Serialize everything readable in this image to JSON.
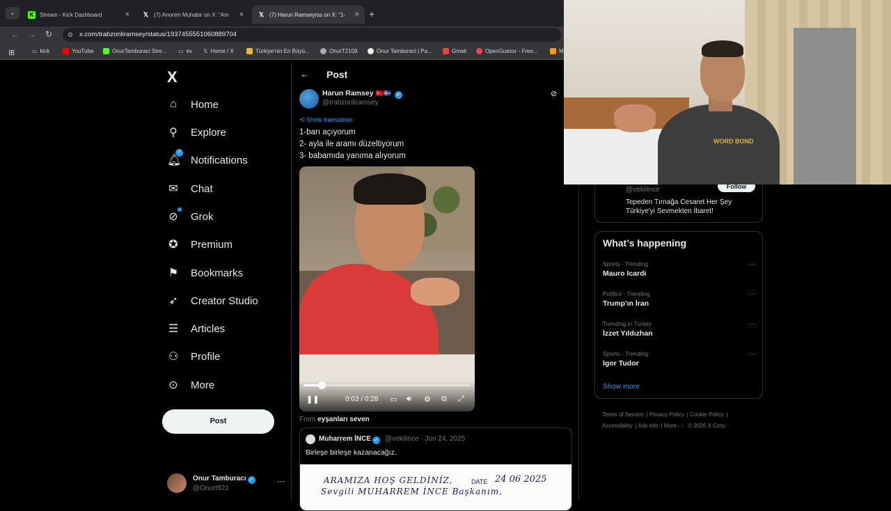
{
  "browser": {
    "tabs": [
      {
        "title": "Stream - Kick Dashboard",
        "favicon": "kick-icon",
        "active": false
      },
      {
        "title": "(7) Anonim Muhabir on X: \"Am",
        "favicon": "x-icon",
        "active": false
      },
      {
        "title": "(7) Harun Ramseyrss on X: \"1-",
        "favicon": "x-icon",
        "active": true
      }
    ],
    "url": "x.com/trabzonliramsey/status/1937455551060889704",
    "bookmarks": [
      "kick",
      "YouTube",
      "OnurTamburaci Stre...",
      "ev",
      "Home / X",
      "Türkiye'nin En Büyü...",
      "OnurT2109",
      "Onur Tamburaci | Pa...",
      "Gmail",
      "OpenGuessr - Free...",
      "M"
    ]
  },
  "sidebar": {
    "logo": "X",
    "items": [
      {
        "label": "Home",
        "icon": "home-icon"
      },
      {
        "label": "Explore",
        "icon": "search-icon"
      },
      {
        "label": "Notifications",
        "icon": "bell-icon",
        "badge": "7"
      },
      {
        "label": "Chat",
        "icon": "mail-icon"
      },
      {
        "label": "Grok",
        "icon": "grok-icon"
      },
      {
        "label": "Premium",
        "icon": "verified-icon"
      },
      {
        "label": "Bookmarks",
        "icon": "bookmark-icon"
      },
      {
        "label": "Creator Studio",
        "icon": "rocket-icon"
      },
      {
        "label": "Articles",
        "icon": "article-icon"
      },
      {
        "label": "Profile",
        "icon": "person-icon"
      },
      {
        "label": "More",
        "icon": "more-circle-icon"
      }
    ],
    "post_button": "Post",
    "account": {
      "name": "Onur Tamburacı",
      "handle": "@Onurt921"
    }
  },
  "main": {
    "title": "Post",
    "author": {
      "name": "Harun Ramsey",
      "flags": "🇹🇷🇮🇸",
      "handle": "@trabzonliramsey"
    },
    "show_translation": "Show translation",
    "text_lines": [
      "1-barı açıyorum",
      "2- ayla ile aramı düzeltiyorum",
      "3- babamıda yanıma alıyorum"
    ],
    "video": {
      "time": "0:03 / 0:28",
      "progress": 0.11
    },
    "from_label": "From",
    "from_source": "eyşanları seven",
    "quote": {
      "name": "Muharrem İNCE",
      "meta": "@vekilince · Jun 24, 2025",
      "text": "Birleşe birleşe kazanacağız.",
      "image_text_1": "ARAMIZA HOŞ GELDİNİZ,",
      "image_text_2": "Sevgili MUHARREM İNCE Başkanım,",
      "image_date_label": "DATE",
      "image_date": "24 06 2025"
    }
  },
  "right": {
    "suggest": {
      "handle": "@vekilince",
      "follow_label": "Follow",
      "bio": "Tepeden Tırnağa Cesaret Her Şey Türkiye'yi Sevmekten İbaret!"
    },
    "happening_title": "What’s happening",
    "trends": [
      {
        "context": "Sports · Trending",
        "name": "Mauro Icardi"
      },
      {
        "context": "Politics · Trending",
        "name": "Trump'ın İran"
      },
      {
        "context": "Trending in Turkey",
        "name": "İzzet Yıldızhan"
      },
      {
        "context": "Sports · Trending",
        "name": "Igor Tudor"
      }
    ],
    "show_more": "Show more",
    "footer": [
      "Terms of Service",
      "Privacy Policy",
      "Cookie Policy",
      "Accessibility",
      "Ads info",
      "More ···",
      "© 2026 X Corp."
    ]
  },
  "webcam": {
    "shirt_text": "WORD BOND"
  },
  "colors": {
    "accent": "#1d9bf0",
    "background": "#000000",
    "text": "#e7e9ea",
    "muted": "#71767b"
  }
}
